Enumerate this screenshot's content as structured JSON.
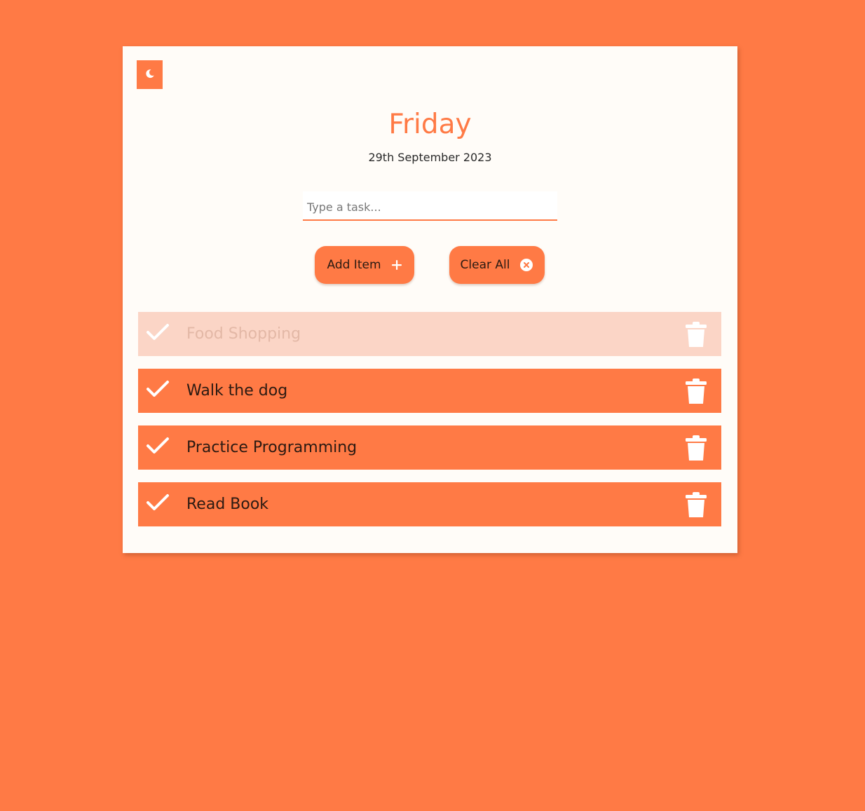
{
  "app": {
    "day": "Friday",
    "date": "29th September 2023"
  },
  "input": {
    "placeholder": "Type a task...",
    "value": ""
  },
  "buttons": {
    "add_label": "Add Item",
    "clear_label": "Clear All"
  },
  "theme_toggle": {
    "icon": "moon-icon"
  },
  "tasks": [
    {
      "label": "Food Shopping",
      "done": true
    },
    {
      "label": "Walk the dog",
      "done": false
    },
    {
      "label": "Practice Programming",
      "done": false
    },
    {
      "label": "Read Book",
      "done": false
    }
  ],
  "colors": {
    "accent": "#ff7a45",
    "card": "#fffcf8",
    "done_row": "#fbd5c6",
    "text_dark": "#2b1a12"
  }
}
